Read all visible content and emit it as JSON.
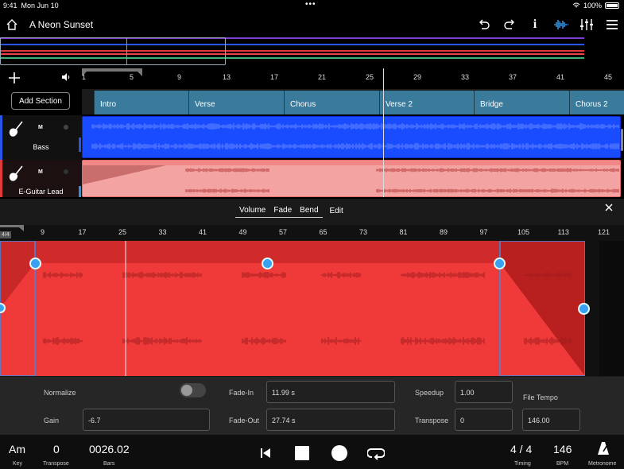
{
  "status": {
    "time": "9:41",
    "date": "Mon Jun 10",
    "battery": "100%"
  },
  "toolbar": {
    "title": "A Neon Sunset"
  },
  "ruler": {
    "bars": [
      "1",
      "5",
      "9",
      "13",
      "17",
      "21",
      "25",
      "29",
      "33",
      "37",
      "41",
      "45"
    ]
  },
  "sections": {
    "add_label": "Add Section",
    "items": [
      "Intro",
      "Verse",
      "Chorus",
      "Verse 2",
      "Bridge",
      "Chorus 2"
    ]
  },
  "tracks": [
    {
      "name": "Bass",
      "mute": "M",
      "color": "#1a4cff"
    },
    {
      "name": "E-Guitar Lead",
      "mute": "M",
      "color": "#f08888"
    }
  ],
  "editor": {
    "tabs": [
      "Volume",
      "Fade",
      "Bend",
      "Edit"
    ],
    "time_signature": "4/4",
    "ruler": [
      "9",
      "17",
      "25",
      "33",
      "41",
      "49",
      "57",
      "65",
      "73",
      "81",
      "89",
      "97",
      "105",
      "113",
      "121"
    ],
    "params": {
      "normalize_label": "Normalize",
      "gain_label": "Gain",
      "gain_value": "-6.7",
      "fade_in_label": "Fade-In",
      "fade_in_value": "11.99 s",
      "fade_out_label": "Fade-Out",
      "fade_out_value": "27.74 s",
      "speedup_label": "Speedup",
      "speedup_value": "1.00",
      "transpose_label": "Transpose",
      "transpose_value": "0",
      "file_tempo_label": "File Tempo",
      "file_tempo_value": "146.00"
    }
  },
  "transport": {
    "key": "Am",
    "key_label": "Key",
    "transpose": "0",
    "transpose_label": "Transpose",
    "bars": "0026.02",
    "bars_label": "Bars",
    "timing": "4 / 4",
    "timing_label": "Timing",
    "bpm": "146",
    "bpm_label": "BPM",
    "metronome_label": "Metronome"
  },
  "colors": {
    "accent": "#2f8fe0",
    "section": "#3a7a9a",
    "audio_red": "#f03a3a"
  }
}
